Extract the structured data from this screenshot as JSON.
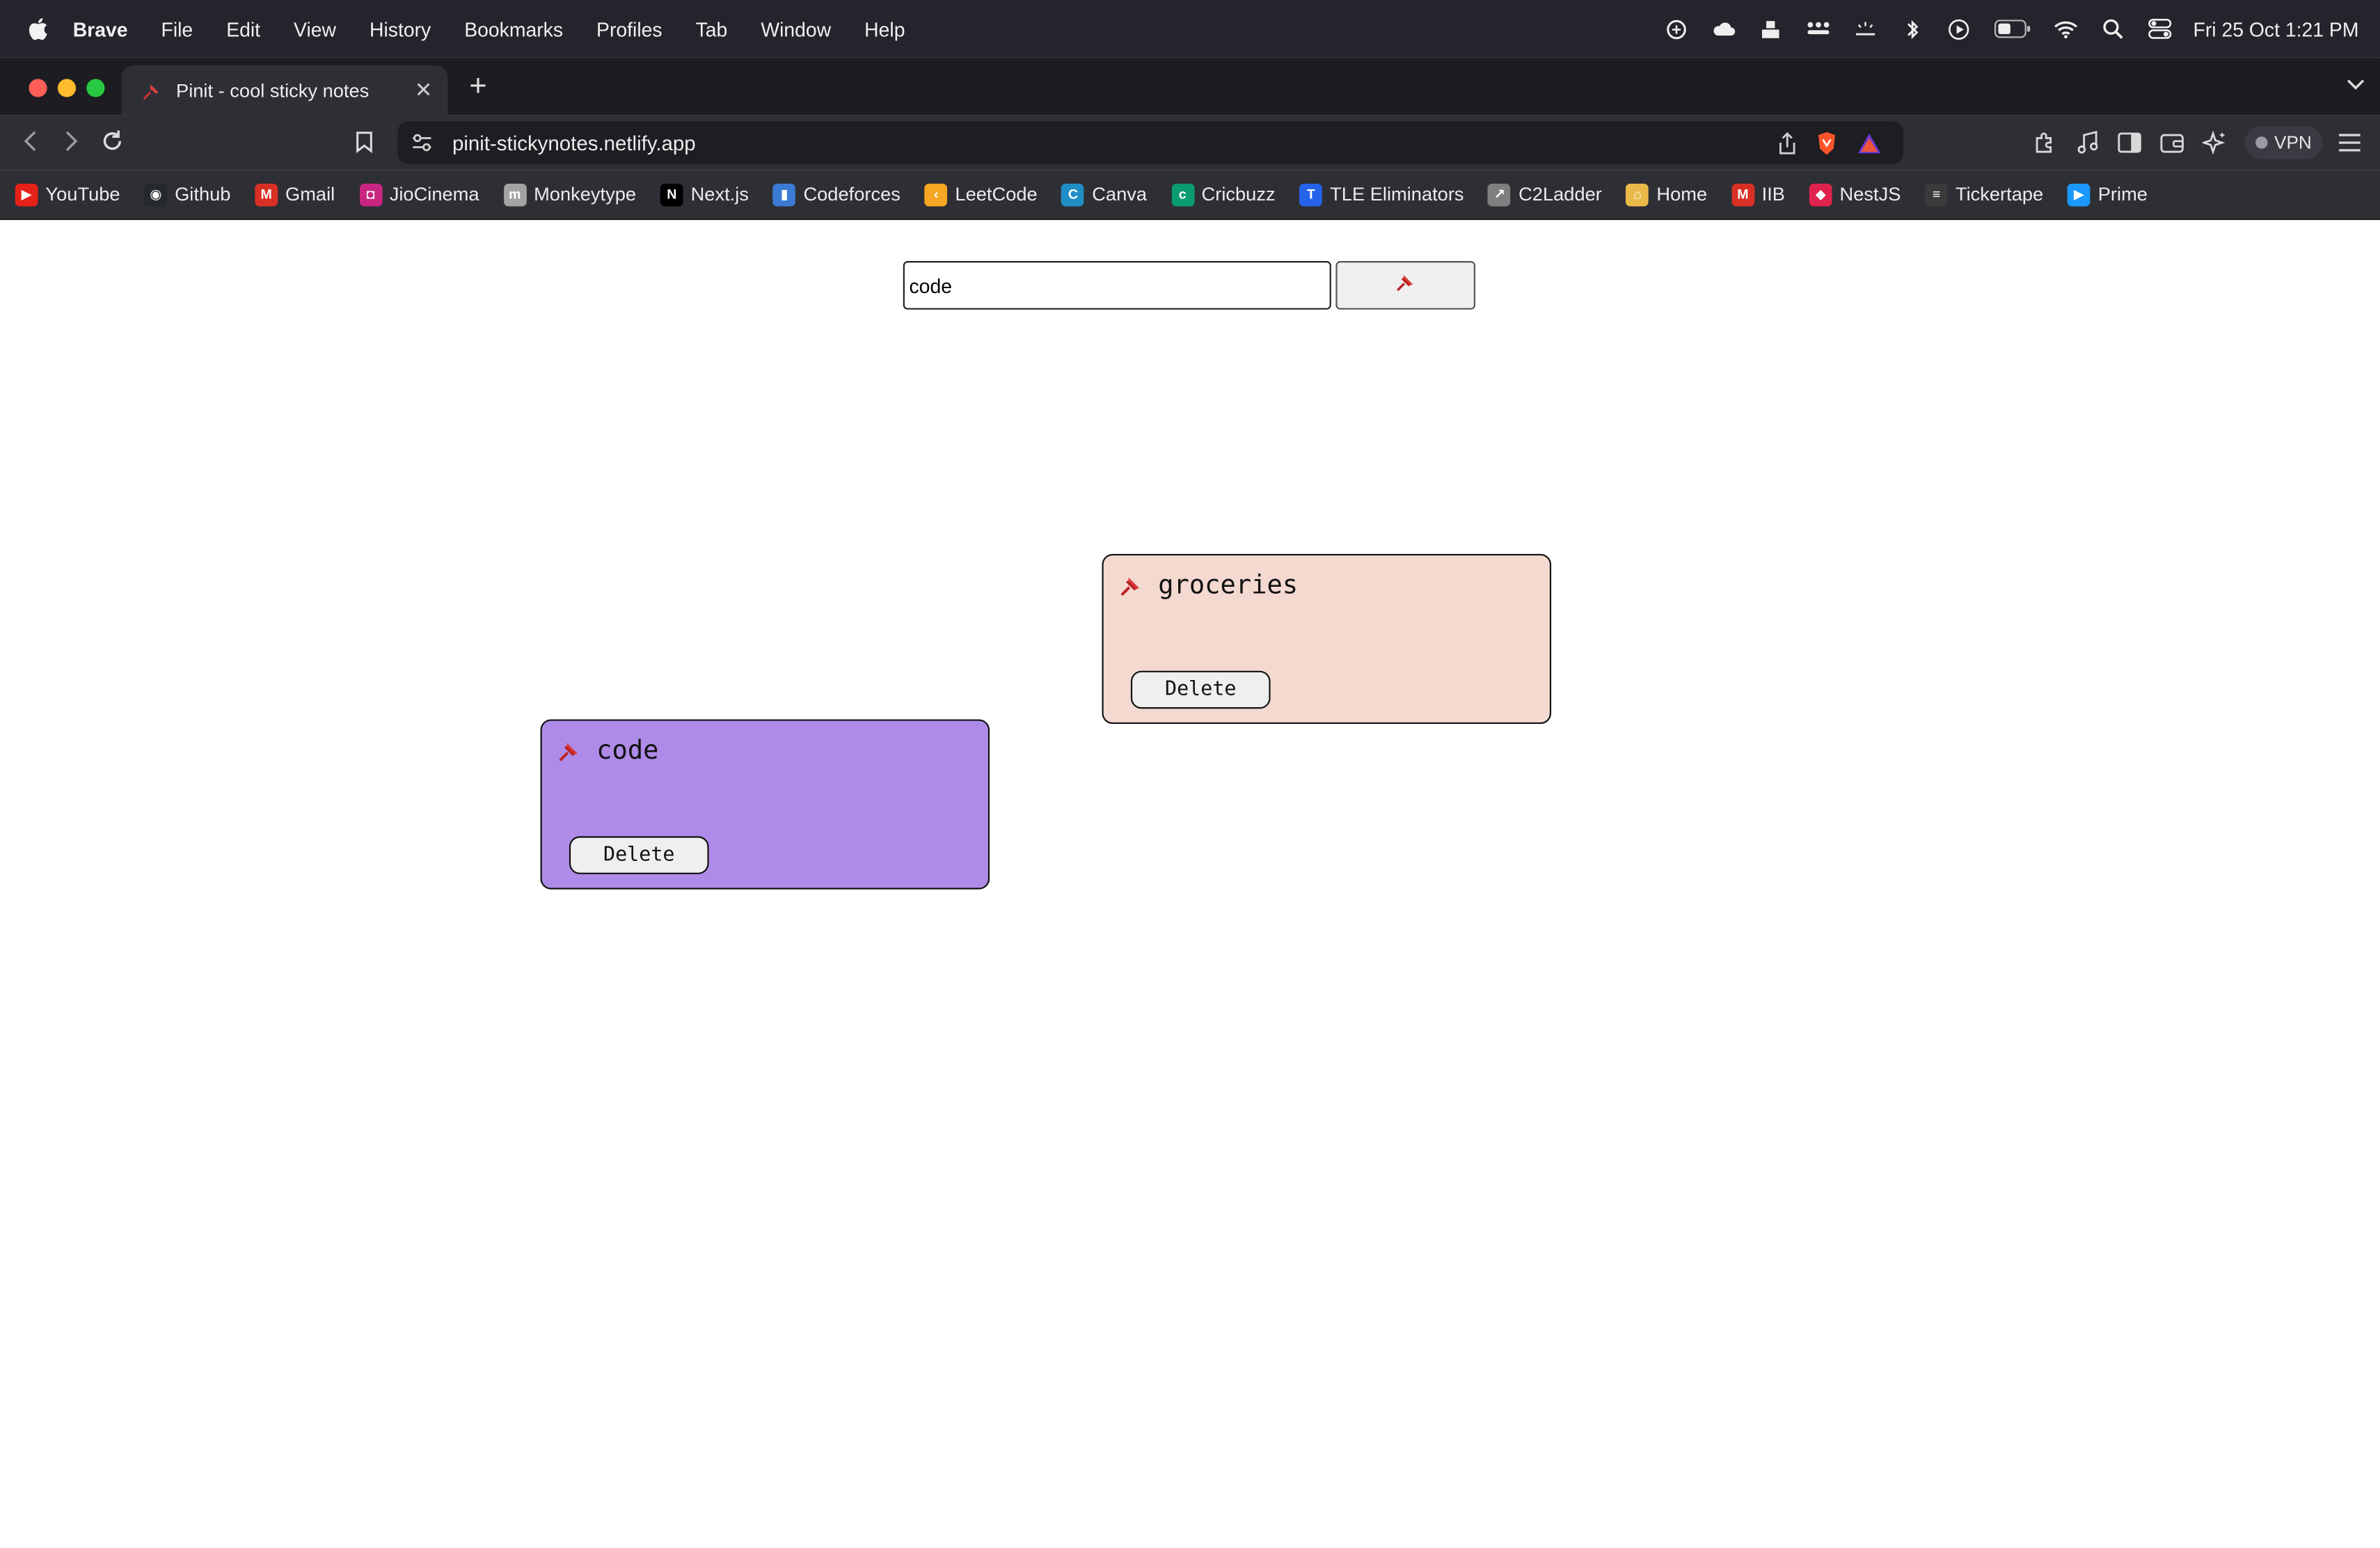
{
  "menubar": {
    "app_name": "Brave",
    "items": [
      "File",
      "Edit",
      "View",
      "History",
      "Bookmarks",
      "Profiles",
      "Tab",
      "Window",
      "Help"
    ],
    "clock": "Fri 25 Oct  1:21 PM",
    "status_icons": [
      "chatgpt-icon",
      "cloud-icon",
      "stack-icon",
      "dots-icon",
      "brightness-icon",
      "bluetooth-icon",
      "play-icon",
      "battery-icon",
      "wifi-icon",
      "search-icon",
      "control-center-icon"
    ]
  },
  "browser": {
    "tab_title": "Pinit - cool sticky notes",
    "url": "pinit-stickynotes.netlify.app",
    "vpn_label": "VPN",
    "bookmarks": [
      {
        "label": "YouTube",
        "icon": "youtube-icon",
        "color": "#e62117"
      },
      {
        "label": "Github",
        "icon": "github-icon",
        "color": "#24292e"
      },
      {
        "label": "Gmail",
        "icon": "gmail-icon",
        "color": "#d93025"
      },
      {
        "label": "JioCinema",
        "icon": "jiocinema-icon",
        "color": "#c72580"
      },
      {
        "label": "Monkeytype",
        "icon": "monkeytype-icon",
        "color": "#a3a3a3"
      },
      {
        "label": "Next.js",
        "icon": "nextjs-icon",
        "color": "#000000"
      },
      {
        "label": "Codeforces",
        "icon": "codeforces-icon",
        "color": "#3b7bd4"
      },
      {
        "label": "LeetCode",
        "icon": "leetcode-icon",
        "color": "#f5a623"
      },
      {
        "label": "Canva",
        "icon": "canva-icon",
        "color": "#1f8ec4"
      },
      {
        "label": "Cricbuzz",
        "icon": "cricbuzz-icon",
        "color": "#0a9b6e"
      },
      {
        "label": "TLE Eliminators",
        "icon": "tle-icon",
        "color": "#2563eb"
      },
      {
        "label": "C2Ladder",
        "icon": "c2ladder-icon",
        "color": "#7f7f7f"
      },
      {
        "label": "Home",
        "icon": "home-icon",
        "color": "#e9b949"
      },
      {
        "label": "IIB",
        "icon": "iib-icon",
        "color": "#d93025"
      },
      {
        "label": "NestJS",
        "icon": "nestjs-icon",
        "color": "#e0234e"
      },
      {
        "label": "Tickertape",
        "icon": "tickertape-icon",
        "color": "#3a3a3a"
      },
      {
        "label": "Prime",
        "icon": "prime-icon",
        "color": "#1a98ff"
      }
    ]
  },
  "app": {
    "input_value": "code",
    "pin_button_icon": "pushpin-icon",
    "notes": [
      {
        "text": "groceries",
        "delete_label": "Delete",
        "color": "#f3d9d0"
      },
      {
        "text": "code",
        "delete_label": "Delete",
        "color": "#ae8be8"
      }
    ]
  }
}
